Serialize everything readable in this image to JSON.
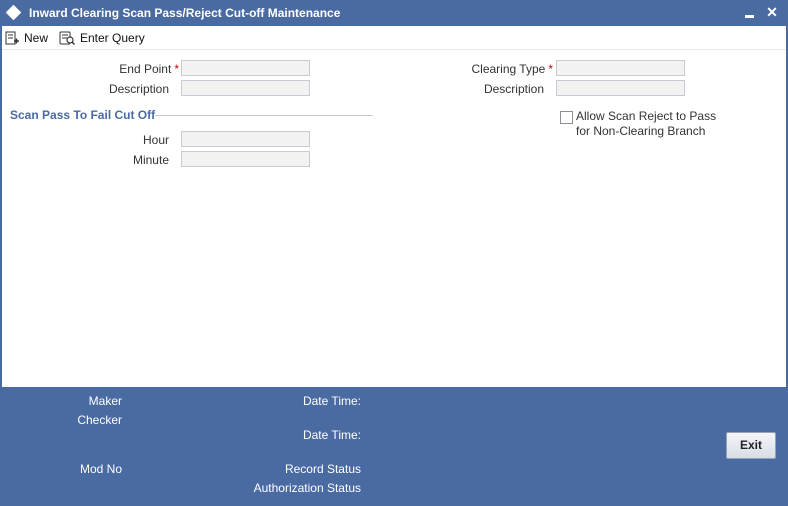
{
  "window": {
    "title": "Inward Clearing Scan Pass/Reject Cut-off Maintenance",
    "close_glyph": "✕"
  },
  "toolbar": {
    "new_label": "New",
    "enter_query_label": "Enter Query"
  },
  "form": {
    "end_point_label": "End Point",
    "description_label": "Description",
    "clearing_type_label": "Clearing Type",
    "description2_label": "Description",
    "required_marker": "*",
    "section_title": "Scan Pass To Fail Cut Off",
    "hour_label": "Hour",
    "minute_label": "Minute",
    "allow_scan_reject_line1": "Allow Scan Reject to Pass",
    "allow_scan_reject_line2": "for Non-Clearing Branch",
    "allow_scan_reject_checked": false
  },
  "footer": {
    "maker_label": "Maker",
    "checker_label": "Checker",
    "date_time_label_1": "Date Time:",
    "date_time_label_2": "Date Time:",
    "mod_no_label": "Mod No",
    "record_status_label": "Record Status",
    "authorization_status_label": "Authorization Status",
    "exit_label": "Exit"
  },
  "colors": {
    "title_bar": "#4a6aa2",
    "section_text": "#4a6aa2",
    "required": "#cc0000"
  }
}
